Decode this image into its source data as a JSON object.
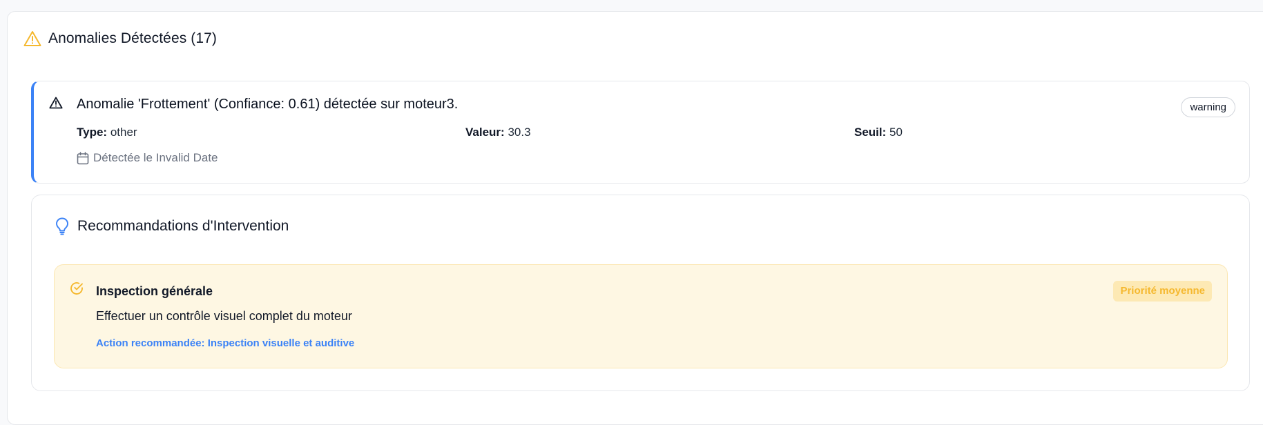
{
  "anomalies": {
    "header_title": "Anomalies Détectées (17)",
    "icon": "alert-triangle-icon",
    "accent_color": "#f5b82e",
    "items": [
      {
        "message": "Anomalie 'Frottement' (Confiance: 0.61) détectée sur moteur3.",
        "severity": "warning",
        "type_label": "Type:",
        "type_value": "other",
        "value_label": "Valeur:",
        "value_value": "30.3",
        "threshold_label": "Seuil:",
        "threshold_value": "50",
        "detected_text": "Détectée le Invalid Date",
        "border_color": "#3b82f6"
      }
    ]
  },
  "recommendations": {
    "header_title": "Recommandations d'Intervention",
    "icon": "lightbulb-icon",
    "items": [
      {
        "title": "Inspection générale",
        "description": "Effectuer un contrôle visuel complet du moteur",
        "action": "Action recommandée: Inspection visuelle et auditive",
        "priority": "Priorité moyenne",
        "background_color": "#fef7e3",
        "priority_color": "#f5b82e"
      }
    ]
  }
}
